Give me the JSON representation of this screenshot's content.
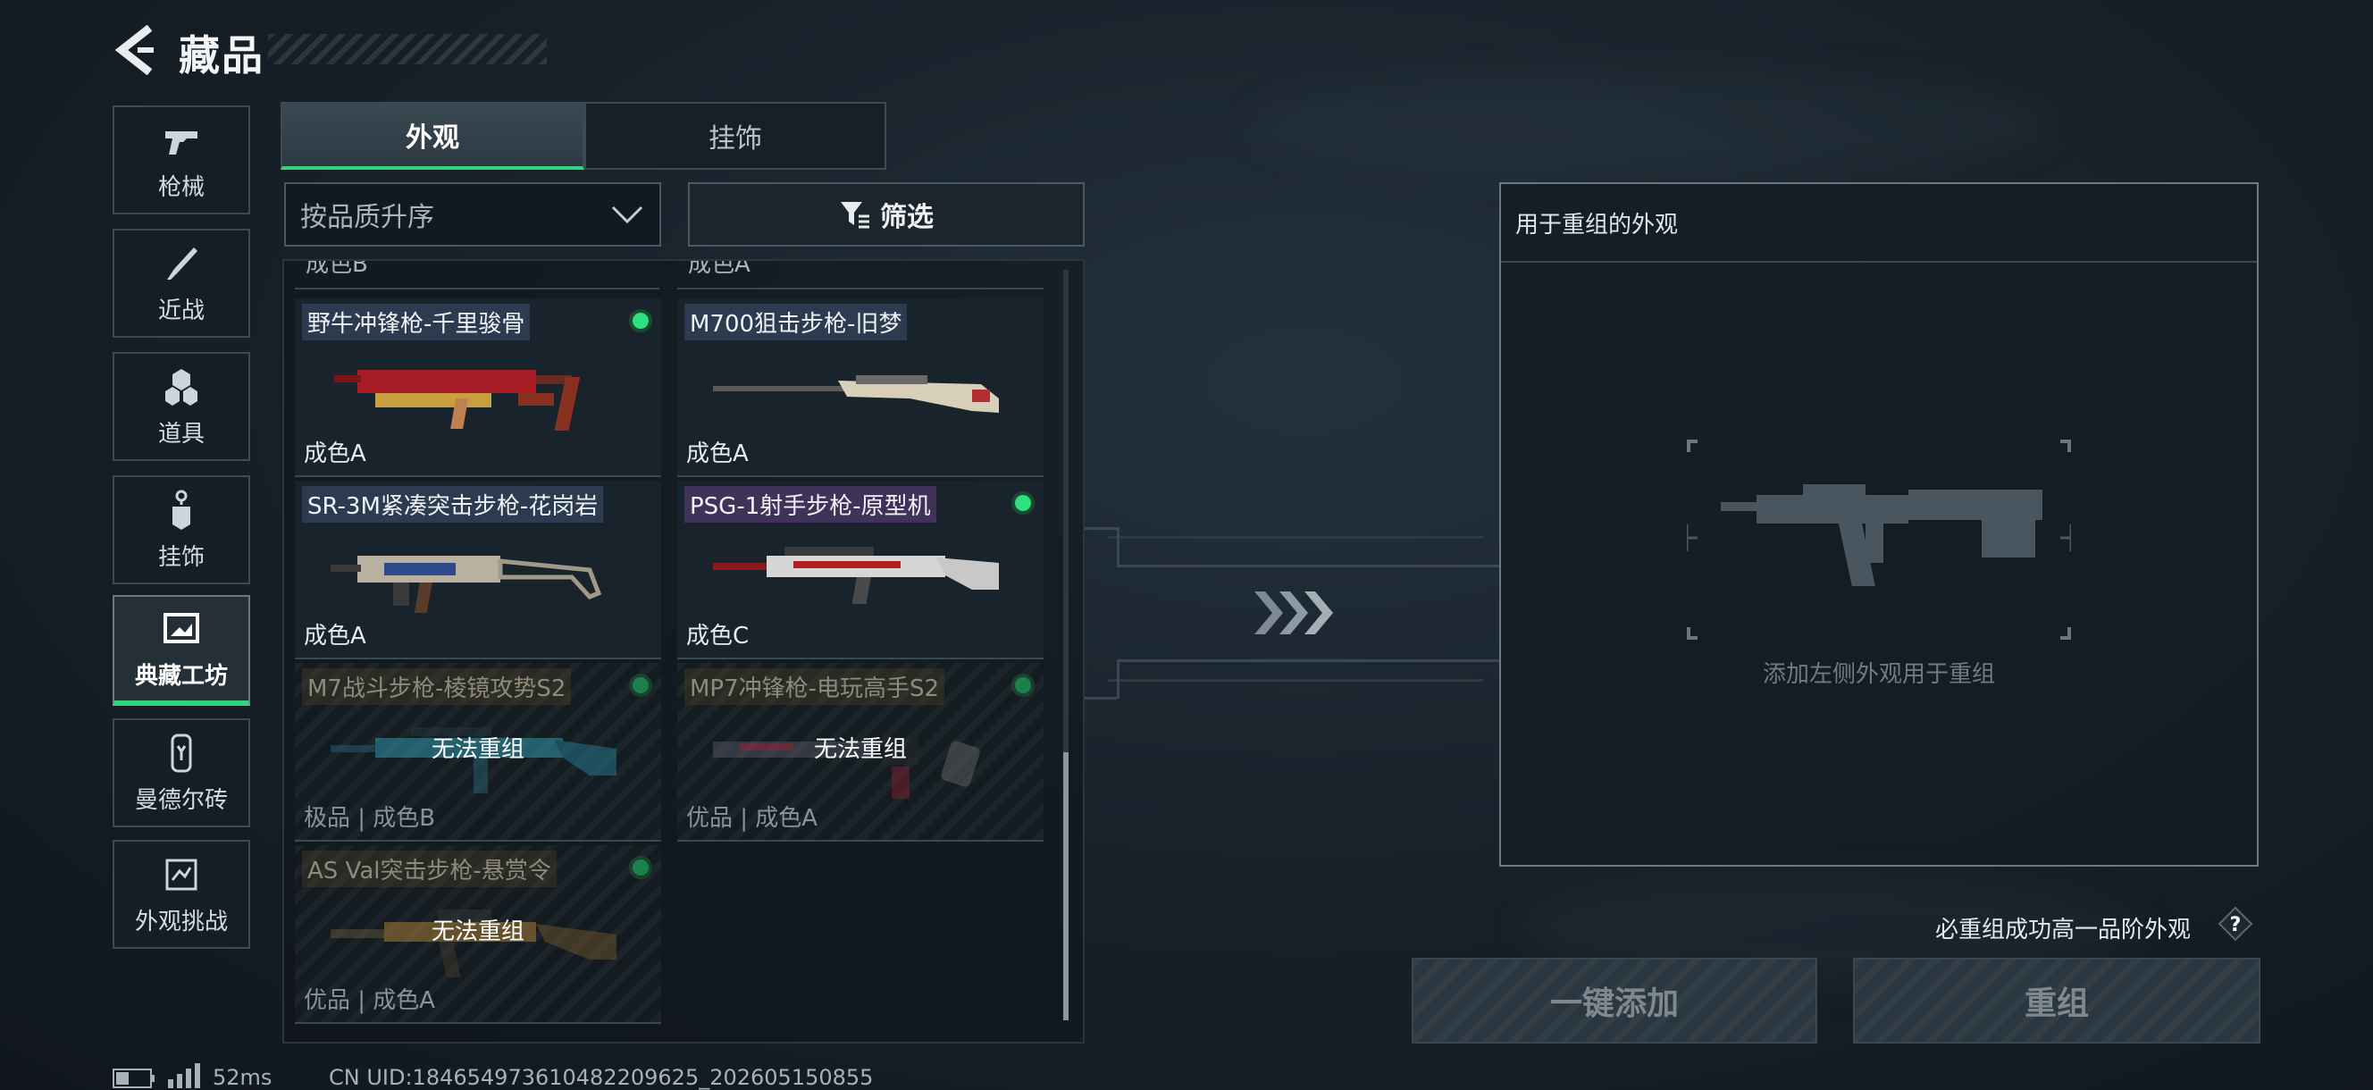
{
  "header": {
    "title": "藏品"
  },
  "nav": [
    {
      "label": "枪械",
      "icon": "pistol-icon",
      "active": false
    },
    {
      "label": "近战",
      "icon": "knife-icon",
      "active": false
    },
    {
      "label": "道具",
      "icon": "grenade-icon",
      "active": false
    },
    {
      "label": "挂饰",
      "icon": "charm-icon",
      "active": false
    },
    {
      "label": "典藏工坊",
      "icon": "workshop-icon",
      "active": true
    },
    {
      "label": "曼德尔砖",
      "icon": "mandel-brick-icon",
      "active": false
    },
    {
      "label": "外观挑战",
      "icon": "challenge-icon",
      "active": false
    }
  ],
  "tabs": [
    {
      "label": "外观",
      "active": true
    },
    {
      "label": "挂饰",
      "active": false
    }
  ],
  "sort": {
    "value": "按品质升序"
  },
  "filter": {
    "label": "筛选"
  },
  "list": {
    "cutoff_left": "成色B",
    "cutoff_right": "成色A",
    "items": [
      {
        "title": "野牛冲锋枪-千里骏骨",
        "quality": "成色A",
        "owned_dot": true,
        "locked": false,
        "accent": "#b8202a"
      },
      {
        "title": "M700狙击步枪-旧梦",
        "quality": "成色A",
        "owned_dot": false,
        "locked": false,
        "accent": "#d8cfb8"
      },
      {
        "title": "SR-3M紧凑突击步枪-花岗岩",
        "quality": "成色A",
        "owned_dot": false,
        "locked": false,
        "accent": "#c9c0b0"
      },
      {
        "title": "PSG-1射手步枪-原型机",
        "quality": "成色C",
        "owned_dot": true,
        "locked": false,
        "accent": "#d9d9d9"
      },
      {
        "title": "M7战斗步枪-棱镜攻势S2",
        "quality": "极品 | 成色B",
        "owned_dot": true,
        "locked": true,
        "locked_text": "无法重组",
        "accent": "#3ab0c8"
      },
      {
        "title": "MP7冲锋枪-电玩高手S2",
        "quality": "优品 | 成色A",
        "owned_dot": true,
        "locked": true,
        "locked_text": "无法重组",
        "accent": "#c8405a"
      },
      {
        "title": "AS Val突击步枪-悬赏令",
        "quality": "优品 | 成色A",
        "owned_dot": true,
        "locked": true,
        "locked_text": "无法重组",
        "accent": "#c8903a"
      }
    ]
  },
  "reassemble": {
    "header": "用于重组的外观",
    "hint": "添加左侧外观用于重组",
    "guarantee": "必重组成功高一品阶外观",
    "add_button": "一键添加",
    "reassemble_button": "重组"
  },
  "footer": {
    "ping": "52ms",
    "uid": "CN UID:184654973610482209625_202605150855"
  },
  "colors": {
    "accent_green": "#32d37c",
    "panel_border": "#6b7983"
  }
}
